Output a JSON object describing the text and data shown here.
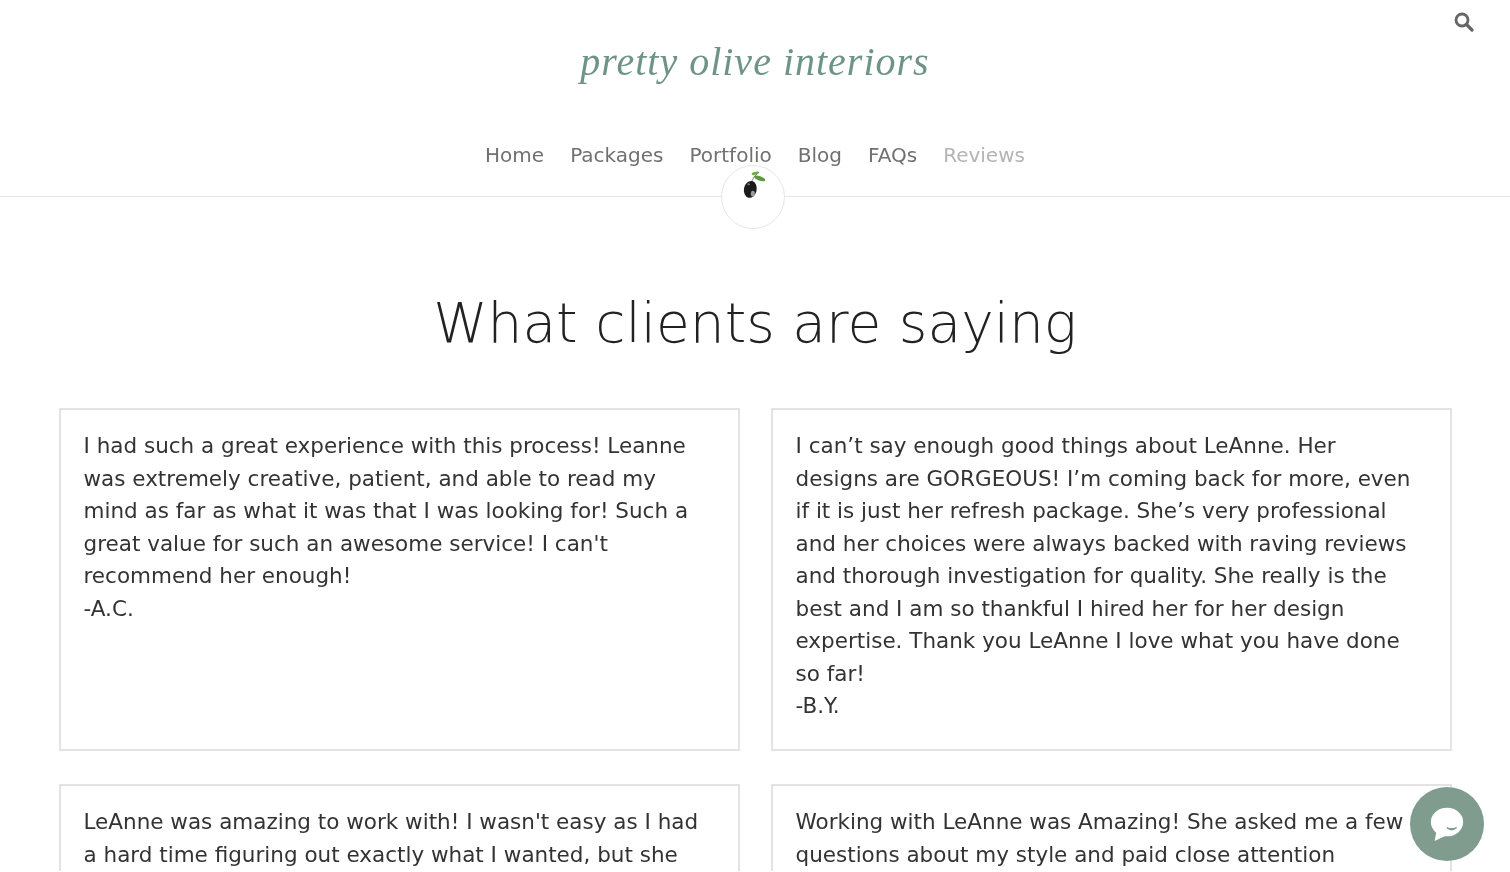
{
  "header": {
    "logo": "pretty olive interiors"
  },
  "nav": {
    "items": [
      {
        "label": "Home",
        "selected": false
      },
      {
        "label": "Packages",
        "selected": false
      },
      {
        "label": "Portfolio",
        "selected": false
      },
      {
        "label": "Blog",
        "selected": false
      },
      {
        "label": "FAQs",
        "selected": false
      },
      {
        "label": "Reviews",
        "selected": true
      }
    ]
  },
  "heading": "What clients are saying",
  "reviews": [
    {
      "text": "I had such a great experience with this process! Leanne was extremely creative, patient, and able to read my mind as far as what it was that I was looking for! Such a great value for such an awesome service! I can't recommend her enough!",
      "author": "-A.C."
    },
    {
      "text": "I can’t say enough good things about LeAnne. Her designs are GORGEOUS! I’m coming back for more, even if it is just her refresh package. She’s very professional and her choices were always backed with raving reviews and thorough investigation for quality. She really is the best and I am so thankful I hired her for her design expertise. Thank you LeAnne I love what you have done so far!",
      "author": "-B.Y."
    },
    {
      "text": "LeAnne was amazing to work with! I wasn't easy as I had a hard time figuring out exactly what I wanted, but she"
    },
    {
      "text": "Working with LeAnne was Amazing! She asked me a few questions about my style and paid close attention"
    }
  ]
}
